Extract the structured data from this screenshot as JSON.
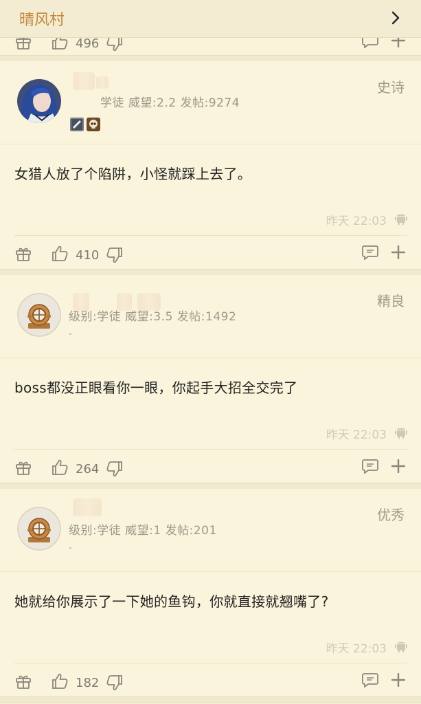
{
  "header": {
    "title": "晴风村"
  },
  "previous_post": {
    "likes": "496"
  },
  "posts": [
    {
      "rank": "史诗",
      "meta": "学徒  威望:2.2  发帖:9274",
      "content": "女猎人放了个陷阱，小怪就踩上去了。",
      "time": "昨天 22:03",
      "likes": "410"
    },
    {
      "rank": "精良",
      "meta": "级别:学徒  威望:3.5  发帖:1492",
      "dash": "-",
      "content": "boss都没正眼看你一眼，你起手大招全交完了",
      "time": "昨天 22:03",
      "likes": "264"
    },
    {
      "rank": "优秀",
      "meta": "级别:学徒  威望:1  发帖:201",
      "dash": "-",
      "content": "她就给你展示了一下她的鱼钩，你就直接就翘嘴了?",
      "time": "昨天 22:03",
      "likes": "182"
    }
  ],
  "icons": [
    "chevron-right-icon",
    "gift-icon",
    "thumbs-up-icon",
    "thumbs-down-icon",
    "comment-icon",
    "plus-icon",
    "android-icon",
    "diver-helmet-icon"
  ],
  "colors": {
    "title": "#c3893a",
    "background": "#faf3d9"
  }
}
